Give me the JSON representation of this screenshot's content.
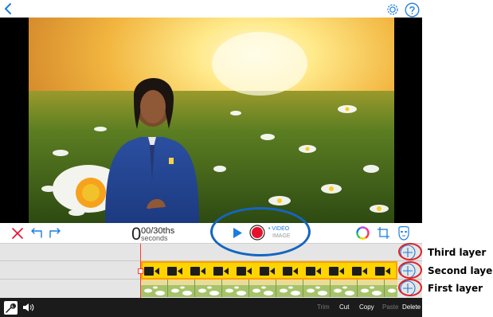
{
  "controls": {
    "time_big": "0",
    "time_frac": "00/30ths",
    "time_unit": "seconds",
    "mode_video": "• VIDEO",
    "mode_image": "IMAGE"
  },
  "edit_bar": {
    "trim": "Trim",
    "cut": "Cut",
    "copy": "Copy",
    "paste": "Paste",
    "delete": "Delete"
  },
  "layers": {
    "third": "Third layer",
    "second": "Second layer",
    "first": "First layer"
  },
  "colors": {
    "accent_blue": "#1a7de0",
    "record_red": "#e8112d",
    "clip_yellow": "#ffd400",
    "playhead_red": "#ff3b30",
    "annotation_blue": "#1565c0",
    "annotation_red": "#e02020"
  },
  "icons": {
    "back": "chevron-left-icon",
    "settings": "gear-icon",
    "help": "question-icon",
    "delete": "x-icon",
    "undo": "undo-icon",
    "redo": "redo-icon",
    "play": "play-icon",
    "record": "record-icon",
    "color": "color-wheel-icon",
    "crop": "crop-icon",
    "mask": "mask-icon",
    "wrench": "wrench-icon",
    "volume": "speaker-icon",
    "add": "plus-circle-icon"
  }
}
